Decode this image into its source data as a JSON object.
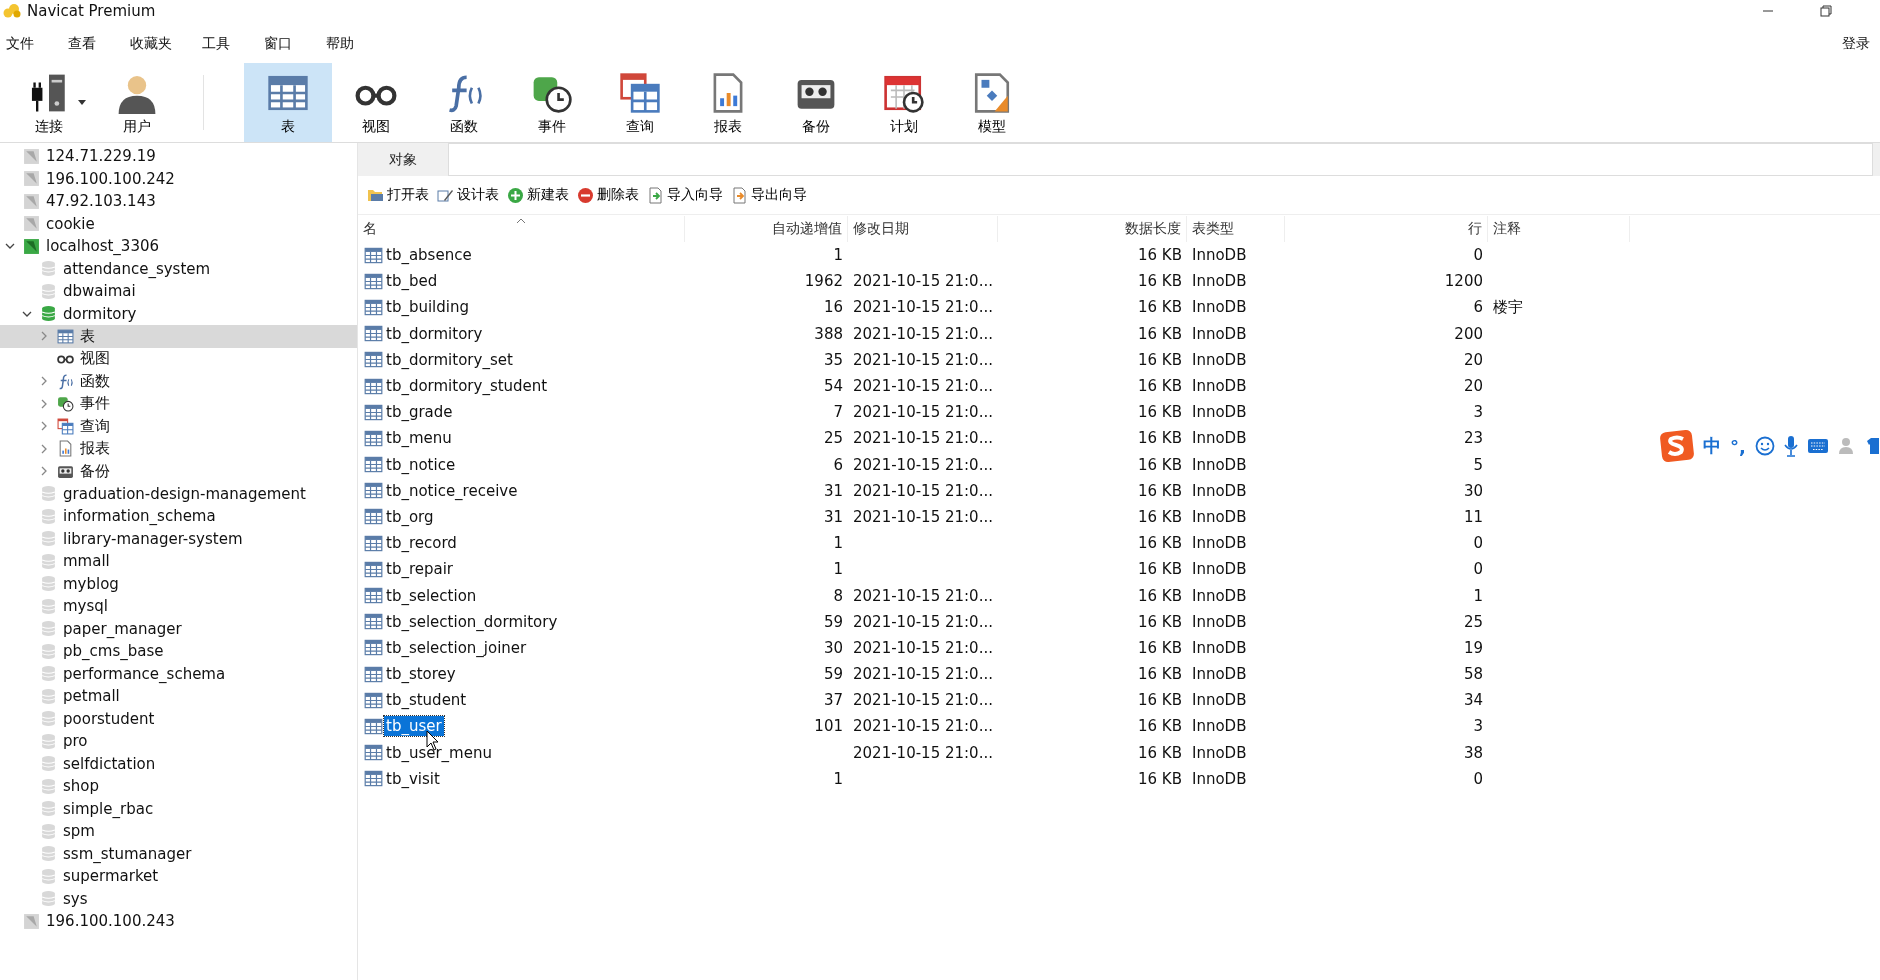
{
  "window": {
    "title": "Navicat Premium"
  },
  "menu": [
    "文件",
    "查看",
    "收藏夹",
    "工具",
    "窗口",
    "帮助"
  ],
  "login": "登录",
  "toolbar": [
    {
      "label": "连接",
      "kind": "connection",
      "selected": false,
      "dropdown": true
    },
    {
      "label": "用户",
      "kind": "user",
      "selected": false,
      "dropdown": false
    },
    {
      "label": "表",
      "kind": "table",
      "selected": true,
      "dropdown": false
    },
    {
      "label": "视图",
      "kind": "view",
      "selected": false,
      "dropdown": false
    },
    {
      "label": "函数",
      "kind": "function",
      "selected": false,
      "dropdown": false
    },
    {
      "label": "事件",
      "kind": "event",
      "selected": false,
      "dropdown": false
    },
    {
      "label": "查询",
      "kind": "query",
      "selected": false,
      "dropdown": false
    },
    {
      "label": "报表",
      "kind": "report",
      "selected": false,
      "dropdown": false
    },
    {
      "label": "备份",
      "kind": "backup",
      "selected": false,
      "dropdown": false
    },
    {
      "label": "计划",
      "kind": "schedule",
      "selected": false,
      "dropdown": false
    },
    {
      "label": "模型",
      "kind": "model",
      "selected": false,
      "dropdown": false
    }
  ],
  "sidebar": {
    "tree": [
      {
        "label": "124.71.229.19",
        "kind": "connection",
        "expanded": false,
        "selected": false
      },
      {
        "label": "196.100.100.242",
        "kind": "connection",
        "expanded": false,
        "selected": false
      },
      {
        "label": "47.92.103.143",
        "kind": "connection",
        "expanded": false,
        "selected": false
      },
      {
        "label": "cookie",
        "kind": "connection",
        "expanded": false,
        "selected": false
      },
      {
        "label": "localhost_3306",
        "kind": "connection",
        "expanded": true,
        "selected": false,
        "children": [
          {
            "label": "attendance_system",
            "kind": "database",
            "expanded": false,
            "selected": false
          },
          {
            "label": "dbwaimai",
            "kind": "database",
            "expanded": false,
            "selected": false
          },
          {
            "label": "dormitory",
            "kind": "database",
            "expanded": true,
            "selected": false,
            "children": [
              {
                "label": "表",
                "kind": "table",
                "expanded": false,
                "selected": true
              },
              {
                "label": "视图",
                "kind": "view",
                "selected": false
              },
              {
                "label": "函数",
                "kind": "function",
                "expanded": false,
                "selected": false
              },
              {
                "label": "事件",
                "kind": "event",
                "expanded": false,
                "selected": false
              },
              {
                "label": "查询",
                "kind": "query",
                "expanded": false,
                "selected": false
              },
              {
                "label": "报表",
                "kind": "report",
                "expanded": false,
                "selected": false
              },
              {
                "label": "备份",
                "kind": "backup",
                "expanded": false,
                "selected": false
              }
            ]
          },
          {
            "label": "graduation-design-management",
            "kind": "database",
            "expanded": false,
            "selected": false
          },
          {
            "label": "information_schema",
            "kind": "database",
            "expanded": false,
            "selected": false
          },
          {
            "label": "library-manager-system",
            "kind": "database",
            "expanded": false,
            "selected": false
          },
          {
            "label": "mmall",
            "kind": "database",
            "expanded": false,
            "selected": false
          },
          {
            "label": "myblog",
            "kind": "database",
            "expanded": false,
            "selected": false
          },
          {
            "label": "mysql",
            "kind": "database",
            "expanded": false,
            "selected": false
          },
          {
            "label": "paper_manager",
            "kind": "database",
            "expanded": false,
            "selected": false
          },
          {
            "label": "pb_cms_base",
            "kind": "database",
            "expanded": false,
            "selected": false
          },
          {
            "label": "performance_schema",
            "kind": "database",
            "expanded": false,
            "selected": false
          },
          {
            "label": "petmall",
            "kind": "database",
            "expanded": false,
            "selected": false
          },
          {
            "label": "poorstudent",
            "kind": "database",
            "expanded": false,
            "selected": false
          },
          {
            "label": "pro",
            "kind": "database",
            "expanded": false,
            "selected": false
          },
          {
            "label": "selfdictation",
            "kind": "database",
            "expanded": false,
            "selected": false
          },
          {
            "label": "shop",
            "kind": "database",
            "expanded": false,
            "selected": false
          },
          {
            "label": "simple_rbac",
            "kind": "database",
            "expanded": false,
            "selected": false
          },
          {
            "label": "spm",
            "kind": "database",
            "expanded": false,
            "selected": false
          },
          {
            "label": "ssm_stumanager",
            "kind": "database",
            "expanded": false,
            "selected": false
          },
          {
            "label": "supermarket",
            "kind": "database",
            "expanded": false,
            "selected": false
          },
          {
            "label": "sys",
            "kind": "database",
            "expanded": false,
            "selected": false
          }
        ]
      },
      {
        "label": "196.100.100.243",
        "kind": "connection",
        "expanded": false,
        "selected": false
      }
    ]
  },
  "tabs": [
    {
      "label": "对象",
      "selected": true
    }
  ],
  "actions": [
    {
      "label": "打开表",
      "kind": "open"
    },
    {
      "label": "设计表",
      "kind": "design"
    },
    {
      "label": "新建表",
      "kind": "new"
    },
    {
      "label": "删除表",
      "kind": "delete"
    },
    {
      "label": "导入向导",
      "kind": "import"
    },
    {
      "label": "导出向导",
      "kind": "export"
    }
  ],
  "table": {
    "columns": [
      "名",
      "自动递增值",
      "修改日期",
      "数据长度",
      "表类型",
      "行",
      "注释"
    ],
    "rows": [
      {
        "name": "tb_absence",
        "auto_increment": "1",
        "modified": "",
        "data_length": "16 KB",
        "engine": "InnoDB",
        "rows": "0",
        "comment": "",
        "selected": false
      },
      {
        "name": "tb_bed",
        "auto_increment": "1962",
        "modified": "2021-10-15 21:0...",
        "data_length": "16 KB",
        "engine": "InnoDB",
        "rows": "1200",
        "comment": "",
        "selected": false
      },
      {
        "name": "tb_building",
        "auto_increment": "16",
        "modified": "2021-10-15 21:0...",
        "data_length": "16 KB",
        "engine": "InnoDB",
        "rows": "6",
        "comment": "楼宇",
        "selected": false
      },
      {
        "name": "tb_dormitory",
        "auto_increment": "388",
        "modified": "2021-10-15 21:0...",
        "data_length": "16 KB",
        "engine": "InnoDB",
        "rows": "200",
        "comment": "",
        "selected": false
      },
      {
        "name": "tb_dormitory_set",
        "auto_increment": "35",
        "modified": "2021-10-15 21:0...",
        "data_length": "16 KB",
        "engine": "InnoDB",
        "rows": "20",
        "comment": "",
        "selected": false
      },
      {
        "name": "tb_dormitory_student",
        "auto_increment": "54",
        "modified": "2021-10-15 21:0...",
        "data_length": "16 KB",
        "engine": "InnoDB",
        "rows": "20",
        "comment": "",
        "selected": false
      },
      {
        "name": "tb_grade",
        "auto_increment": "7",
        "modified": "2021-10-15 21:0...",
        "data_length": "16 KB",
        "engine": "InnoDB",
        "rows": "3",
        "comment": "",
        "selected": false
      },
      {
        "name": "tb_menu",
        "auto_increment": "25",
        "modified": "2021-10-15 21:0...",
        "data_length": "16 KB",
        "engine": "InnoDB",
        "rows": "23",
        "comment": "",
        "selected": false
      },
      {
        "name": "tb_notice",
        "auto_increment": "6",
        "modified": "2021-10-15 21:0...",
        "data_length": "16 KB",
        "engine": "InnoDB",
        "rows": "5",
        "comment": "",
        "selected": false
      },
      {
        "name": "tb_notice_receive",
        "auto_increment": "31",
        "modified": "2021-10-15 21:0...",
        "data_length": "16 KB",
        "engine": "InnoDB",
        "rows": "30",
        "comment": "",
        "selected": false
      },
      {
        "name": "tb_org",
        "auto_increment": "31",
        "modified": "2021-10-15 21:0...",
        "data_length": "16 KB",
        "engine": "InnoDB",
        "rows": "11",
        "comment": "",
        "selected": false
      },
      {
        "name": "tb_record",
        "auto_increment": "1",
        "modified": "",
        "data_length": "16 KB",
        "engine": "InnoDB",
        "rows": "0",
        "comment": "",
        "selected": false
      },
      {
        "name": "tb_repair",
        "auto_increment": "1",
        "modified": "",
        "data_length": "16 KB",
        "engine": "InnoDB",
        "rows": "0",
        "comment": "",
        "selected": false
      },
      {
        "name": "tb_selection",
        "auto_increment": "8",
        "modified": "2021-10-15 21:0...",
        "data_length": "16 KB",
        "engine": "InnoDB",
        "rows": "1",
        "comment": "",
        "selected": false
      },
      {
        "name": "tb_selection_dormitory",
        "auto_increment": "59",
        "modified": "2021-10-15 21:0...",
        "data_length": "16 KB",
        "engine": "InnoDB",
        "rows": "25",
        "comment": "",
        "selected": false
      },
      {
        "name": "tb_selection_joiner",
        "auto_increment": "30",
        "modified": "2021-10-15 21:0...",
        "data_length": "16 KB",
        "engine": "InnoDB",
        "rows": "19",
        "comment": "",
        "selected": false
      },
      {
        "name": "tb_storey",
        "auto_increment": "59",
        "modified": "2021-10-15 21:0...",
        "data_length": "16 KB",
        "engine": "InnoDB",
        "rows": "58",
        "comment": "",
        "selected": false
      },
      {
        "name": "tb_student",
        "auto_increment": "37",
        "modified": "2021-10-15 21:0...",
        "data_length": "16 KB",
        "engine": "InnoDB",
        "rows": "34",
        "comment": "",
        "selected": false
      },
      {
        "name": "tb_user",
        "auto_increment": "101",
        "modified": "2021-10-15 21:0...",
        "data_length": "16 KB",
        "engine": "InnoDB",
        "rows": "3",
        "comment": "",
        "selected": true
      },
      {
        "name": "tb_user_menu",
        "auto_increment": "",
        "modified": "2021-10-15 21:0...",
        "data_length": "16 KB",
        "engine": "InnoDB",
        "rows": "38",
        "comment": "",
        "selected": false
      },
      {
        "name": "tb_visit",
        "auto_increment": "1",
        "modified": "",
        "data_length": "16 KB",
        "engine": "InnoDB",
        "rows": "0",
        "comment": "",
        "selected": false
      }
    ]
  },
  "ime_toolbar": {
    "items": [
      {
        "kind": "logo"
      },
      {
        "kind": "text",
        "label": "中"
      },
      {
        "kind": "text",
        "label": "°,"
      },
      {
        "kind": "emoji"
      },
      {
        "kind": "mic"
      },
      {
        "kind": "keyboard"
      },
      {
        "kind": "user"
      },
      {
        "kind": "skin"
      }
    ]
  }
}
